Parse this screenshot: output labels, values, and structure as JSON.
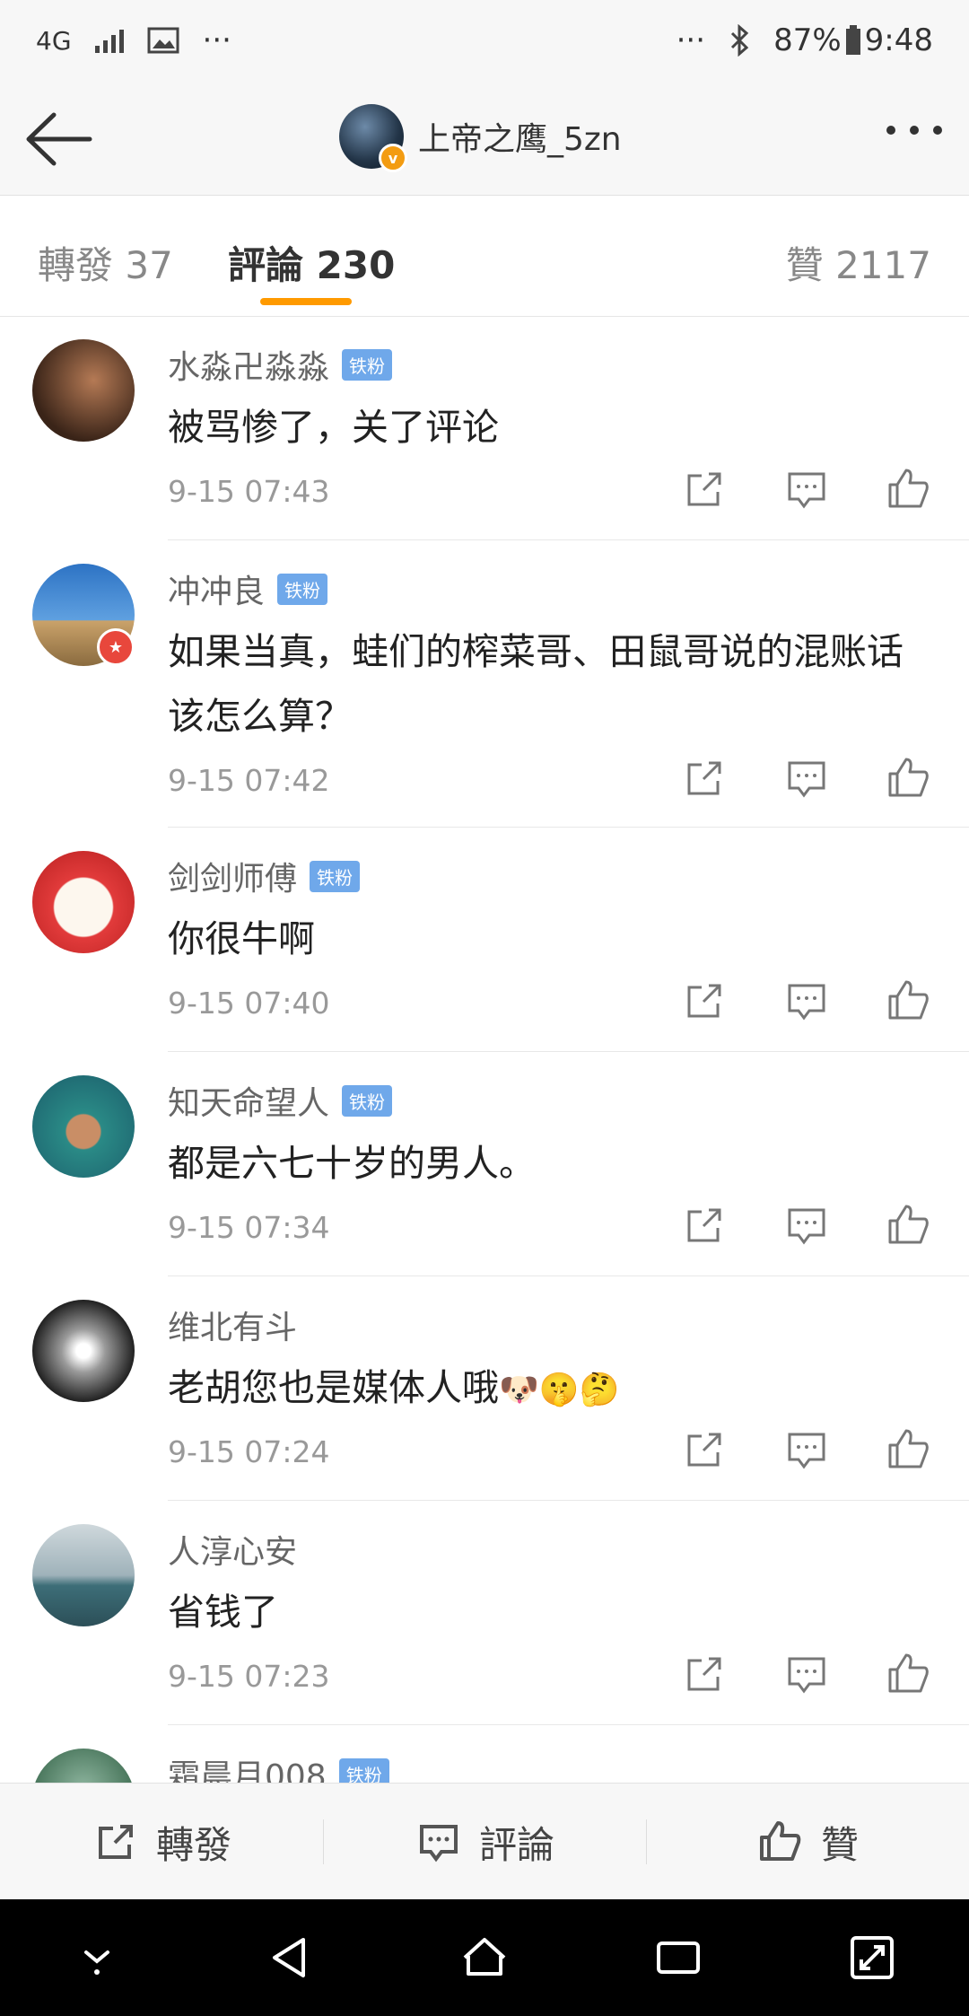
{
  "status_bar": {
    "network": "4G",
    "battery": "87%",
    "time": "9:48",
    "more": "···"
  },
  "header": {
    "username": "上帝之鹰_5zn"
  },
  "tabs": [
    {
      "label": "轉發 37"
    },
    {
      "label": "評論 230"
    },
    {
      "label": "贊 2117"
    }
  ],
  "comments": [
    {
      "user": "水淼卍淼淼",
      "badge": "铁粉",
      "text": "被骂惨了，关了评论",
      "time": "9-15 07:43"
    },
    {
      "user": "冲冲良",
      "badge": "铁粉",
      "text": "如果当真，蛙们的榨菜哥、田鼠哥说的混账话该怎么算？",
      "time": "9-15 07:42"
    },
    {
      "user": "剑剑师傅",
      "badge": "铁粉",
      "text": "你很牛啊",
      "time": "9-15 07:40"
    },
    {
      "user": "知天命望人",
      "badge": "铁粉",
      "text": "都是六七十岁的男人。",
      "time": "9-15 07:34"
    },
    {
      "user": "维北有斗",
      "badge": "",
      "text": "老胡您也是媒体人哦",
      "emoji": "🐶🤫🤔",
      "time": "9-15 07:24"
    },
    {
      "user": "人淳心安",
      "badge": "",
      "text": "省钱了",
      "time": "9-15 07:23"
    },
    {
      "user": "霜晨月008",
      "badge": "铁粉",
      "text": "",
      "time": ""
    }
  ],
  "bottom_bar": {
    "repost": "轉發",
    "comment": "評論",
    "like": "贊"
  },
  "colors": {
    "accent": "#ff9a00",
    "fan_badge": "#6fa8ea",
    "verified": "#f39c12"
  }
}
